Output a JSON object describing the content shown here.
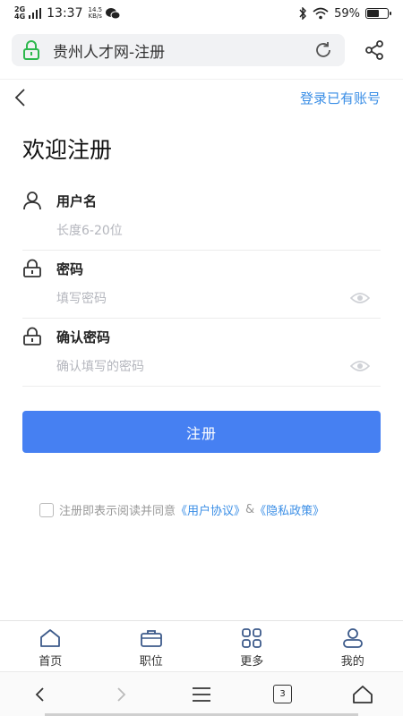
{
  "status_bar": {
    "net_top": "2G",
    "net_bottom": "4G",
    "time": "13:37",
    "speed_value": "14.5",
    "speed_unit": "KB/s",
    "battery_percent": "59%",
    "battery_level": 0.59
  },
  "browser": {
    "address_title": "贵州人才网-注册",
    "tab_count": "3"
  },
  "header": {
    "login_link": "登录已有账号"
  },
  "page": {
    "title": "欢迎注册"
  },
  "form": {
    "username": {
      "label": "用户名",
      "placeholder": "长度6-20位",
      "value": ""
    },
    "password": {
      "label": "密码",
      "placeholder": "填写密码",
      "value": ""
    },
    "confirm": {
      "label": "确认密码",
      "placeholder": "确认填写的密码",
      "value": ""
    },
    "submit_label": "注册"
  },
  "agreement": {
    "prefix": "注册即表示阅读并同意",
    "user_agreement": "《用户协议》",
    "joiner": "&",
    "privacy_policy": "《隐私政策》",
    "checked": false
  },
  "tab_bar": {
    "items": [
      {
        "label": "首页",
        "icon": "home-icon"
      },
      {
        "label": "职位",
        "icon": "briefcase-icon"
      },
      {
        "label": "更多",
        "icon": "grid-icon"
      },
      {
        "label": "我的",
        "icon": "user-icon"
      }
    ]
  },
  "colors": {
    "accent": "#4680f2",
    "link": "#3a8ee6",
    "secure": "#2db84d"
  }
}
